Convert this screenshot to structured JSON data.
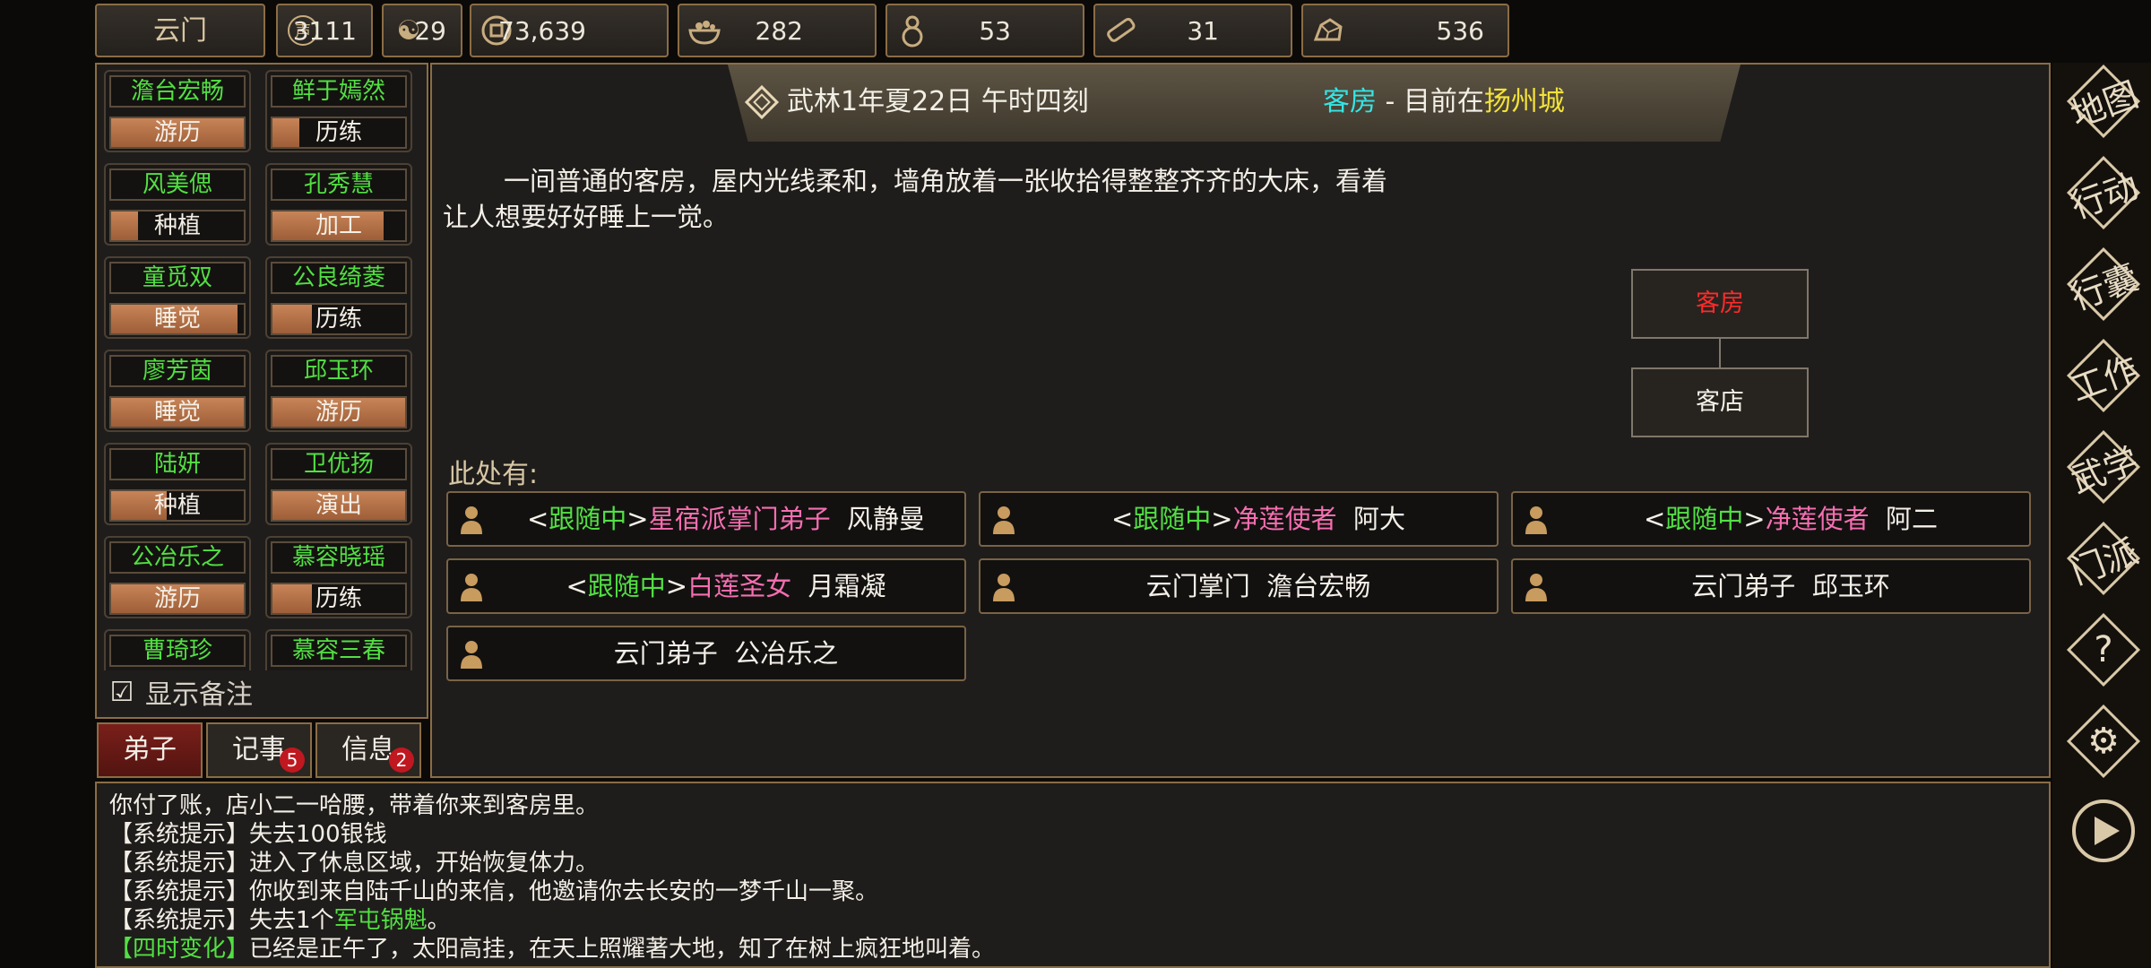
{
  "resources": {
    "sect": "云门",
    "reputation": "3111",
    "yinyang": "29",
    "money": "73,639",
    "food": "282",
    "herbs": "53",
    "wood": "31",
    "ore": "536"
  },
  "disciples": [
    {
      "name": "澹台宏畅",
      "activity": "游历",
      "progress": 1.0
    },
    {
      "name": "鲜于嫣然",
      "activity": "历练",
      "progress": 0.2
    },
    {
      "name": "风美偲",
      "activity": "种植",
      "progress": 0.2
    },
    {
      "name": "孔秀慧",
      "activity": "加工",
      "progress": 0.84
    },
    {
      "name": "童觅双",
      "activity": "睡觉",
      "progress": 0.95
    },
    {
      "name": "公良绮菱",
      "activity": "历练",
      "progress": 0.3
    },
    {
      "name": "廖芳茵",
      "activity": "睡觉",
      "progress": 1.0
    },
    {
      "name": "邱玉环",
      "activity": "游历",
      "progress": 1.0
    },
    {
      "name": "陆妍",
      "activity": "种植",
      "progress": 0.42
    },
    {
      "name": "卫优扬",
      "activity": "演出",
      "progress": 1.0
    },
    {
      "name": "公冶乐之",
      "activity": "游历",
      "progress": 1.0
    },
    {
      "name": "慕容晓瑶",
      "activity": "历练",
      "progress": 0.3
    },
    {
      "name": "曹琦珍",
      "activity": "",
      "progress": 0
    },
    {
      "name": "慕容三春",
      "activity": "",
      "progress": 0
    }
  ],
  "show_notes_label": "显示备注",
  "tabs": [
    {
      "label": "弟子",
      "badge": ""
    },
    {
      "label": "记事",
      "badge": "5"
    },
    {
      "label": "信息",
      "badge": "2"
    }
  ],
  "header": {
    "datetime": "武林1年夏22日 午时四刻",
    "room": "客房",
    "separator": " - ",
    "location_prefix": "目前在",
    "city": "扬州城"
  },
  "description": "一间普通的客房，屋内光线柔和，墙角放着一张收拾得整整齐齐的大床，看着让人想要好好睡上一觉。",
  "map": {
    "current": "客房",
    "connected": "客店",
    "current_color": "#ff2a2a"
  },
  "here_label": "此处有:",
  "npcs": [
    {
      "tag_open": "<",
      "status": "跟随中",
      "tag_close": ">",
      "title": "星宿派掌门弟子",
      "name": "风静曼"
    },
    {
      "tag_open": "<",
      "status": "跟随中",
      "tag_close": ">",
      "title": "净莲使者",
      "name": "阿大"
    },
    {
      "tag_open": "<",
      "status": "跟随中",
      "tag_close": ">",
      "title": "净莲使者",
      "name": "阿二"
    },
    {
      "tag_open": "<",
      "status": "跟随中",
      "tag_close": ">",
      "title": "白莲圣女",
      "name": "月霜凝"
    },
    {
      "tag_open": "",
      "status": "",
      "tag_close": "",
      "title": "云门掌门",
      "name": "澹台宏畅"
    },
    {
      "tag_open": "",
      "status": "",
      "tag_close": "",
      "title": "云门弟子",
      "name": "邱玉环"
    },
    {
      "tag_open": "",
      "status": "",
      "tag_close": "",
      "title": "云门弟子",
      "name": "公冶乐之"
    }
  ],
  "log": [
    {
      "prefix": "",
      "highlight": "",
      "text": "你付了账，店小二一哈腰，带着你来到客房里。"
    },
    {
      "prefix": "【系统提示】",
      "highlight": "",
      "text": "失去100银钱"
    },
    {
      "prefix": "【系统提示】",
      "highlight": "",
      "text": "进入了休息区域，开始恢复体力。"
    },
    {
      "prefix": "【系统提示】",
      "highlight": "",
      "text": "你收到来自陆千山的来信，他邀请你去长安的一梦千山一聚。"
    },
    {
      "prefix": "【系统提示】",
      "highlight": "军屯锅魁",
      "text": "失去1个",
      "suffix": "。"
    },
    {
      "prefix": "【四时变化】",
      "highlight": "",
      "text": "已经是正午了，太阳高挂，在天上照耀著大地，知了在树上疯狂地叫着。"
    }
  ],
  "right_menu": [
    {
      "label": "地图",
      "icon": "map"
    },
    {
      "label": "行动",
      "icon": "action"
    },
    {
      "label": "行囊",
      "icon": "bag"
    },
    {
      "label": "工作",
      "icon": "work"
    },
    {
      "label": "武学",
      "icon": "martial"
    },
    {
      "label": "门派",
      "icon": "sect"
    },
    {
      "label": "?",
      "icon": "help-icon"
    },
    {
      "label": "⚙",
      "icon": "gear-icon"
    },
    {
      "label": "▶",
      "icon": "play-icon"
    }
  ],
  "colors": {
    "border": "#8a6d45",
    "green": "#52e043",
    "pink": "#f56eb0",
    "cyan": "#33e6e6",
    "yellow": "#f3e23a",
    "active_tab": "#7a1f1a"
  }
}
